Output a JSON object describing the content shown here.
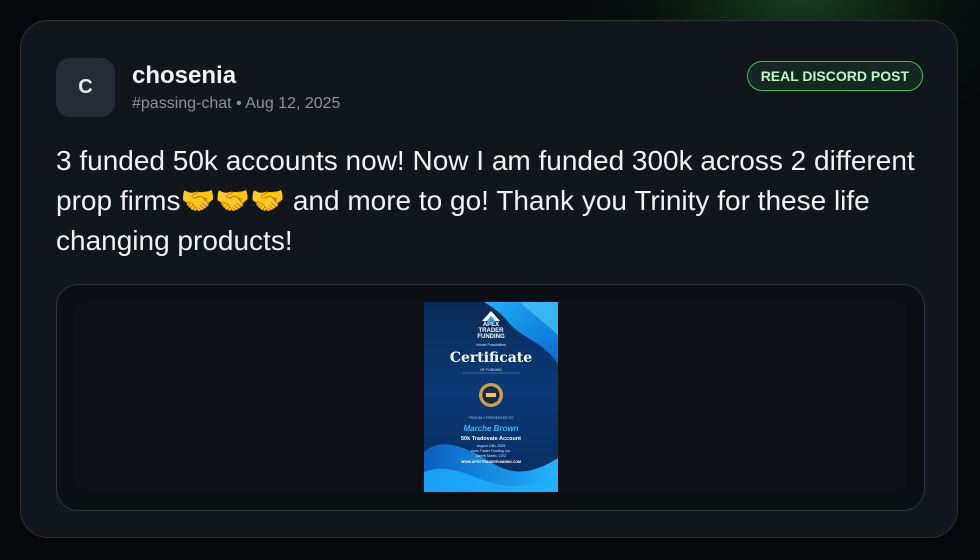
{
  "post": {
    "avatar_letter": "C",
    "username": "chosenia",
    "channel": "#passing-chat",
    "separator": "•",
    "date": "Aug 12, 2025",
    "badge": "REAL DISCORD POST",
    "message": "3 funded 50k accounts now! Now I am funded 300k across 2 different prop firms🤝🤝🤝 and more to go! Thank you Trinity for these life changing products!"
  },
  "certificate": {
    "brand_line1": "APEX",
    "brand_line2": "TRADER",
    "brand_line3": "FUNDING",
    "tagline": "Infinite Possibilities",
    "title": "Certificate",
    "subtitle": "OF FUNDING",
    "presents": "PROUDLY PRESENTED TO",
    "recipient": "Marche Brown",
    "account": "50k Tradovate Account",
    "date_line": "August 10th, 2025",
    "company_line": "Apex Trader Funding, Inc.",
    "signer_line": "Darrell Martin, CEO",
    "url": "WWW.APEXTRADERFUNDING.COM",
    "colors": {
      "background": "#0b3a78",
      "wave": "#1aa3ff",
      "accent_name": "#39b6ff"
    }
  },
  "icons": {
    "logo": "apex-logo-icon",
    "award": "award-seal-icon"
  }
}
